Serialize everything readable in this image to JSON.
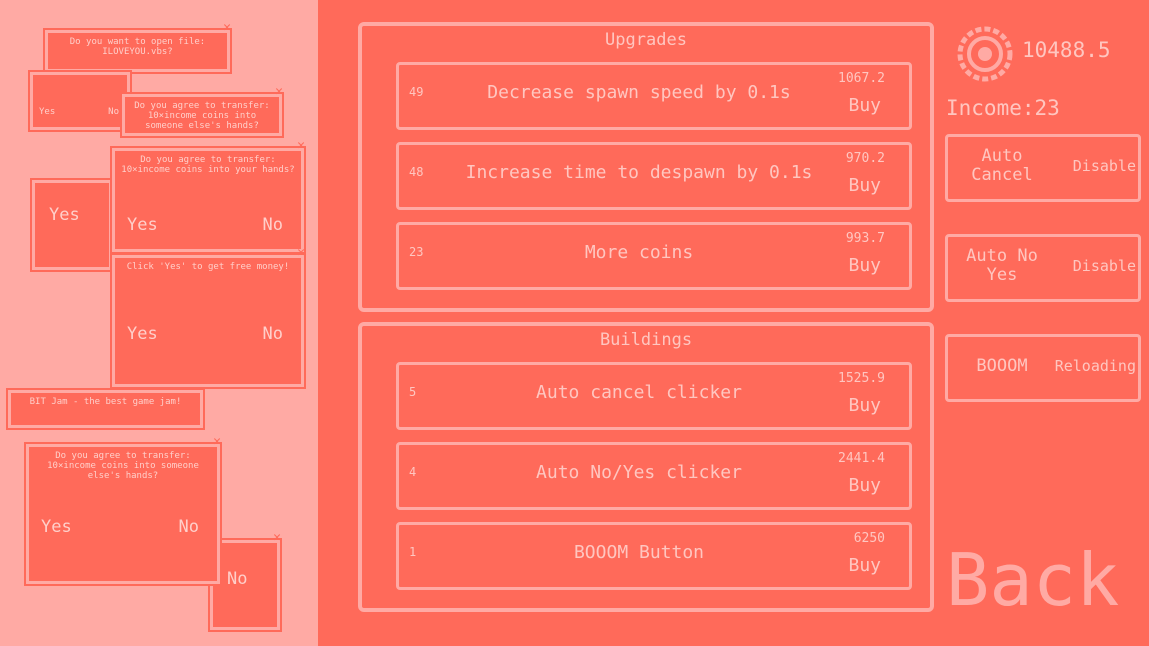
{
  "colors": {
    "background": "#ff6a5a",
    "accent": "#ffaaa4"
  },
  "popups": [
    {
      "msg": "Do you want to open file: ILOVEYOU.vbs?",
      "yes": "",
      "no": ""
    },
    {
      "msg": "Do you agree to transfer: 10×income coins into someone else's hands?",
      "yes": "Yes",
      "no": "No"
    },
    {
      "msg": "Do you agree to transfer: 10×income coins into your hands?",
      "yes": "Yes",
      "no": "No"
    },
    {
      "msg": "Click 'Yes' to get free money!",
      "yes": "Yes",
      "no": "No"
    },
    {
      "msg": "BIT Jam - the best game jam!",
      "yes": "",
      "no": ""
    },
    {
      "msg": "Do you agree to transfer: 10×income coins into someone else's hands?",
      "yes": "Yes",
      "no": "No"
    },
    {
      "msg": "",
      "yes": "Yes",
      "no": ""
    },
    {
      "msg": "",
      "yes": "",
      "no": "No"
    }
  ],
  "upgrades": {
    "title": "Upgrades",
    "items": [
      {
        "count": "49",
        "name": "Decrease spawn speed by 0.1s",
        "price": "1067.2",
        "buy": "Buy"
      },
      {
        "count": "48",
        "name": "Increase time to despawn by 0.1s",
        "price": "970.2",
        "buy": "Buy"
      },
      {
        "count": "23",
        "name": "More coins",
        "price": "993.7",
        "buy": "Buy"
      }
    ]
  },
  "buildings": {
    "title": "Buildings",
    "items": [
      {
        "count": "5",
        "name": "Auto cancel clicker",
        "price": "1525.9",
        "buy": "Buy"
      },
      {
        "count": "4",
        "name": "Auto No/Yes clicker",
        "price": "2441.4",
        "buy": "Buy"
      },
      {
        "count": "1",
        "name": "BOOOM Button",
        "price": "6250",
        "buy": "Buy"
      }
    ]
  },
  "stats": {
    "coins": "10488.5",
    "income": "Income:23",
    "coin_icon": "coin-icon"
  },
  "toggles": [
    {
      "label": "Auto Cancel",
      "action": "Disable"
    },
    {
      "label": "Auto No Yes",
      "action": "Disable"
    },
    {
      "label": "BOOOM",
      "action": "Reloading"
    }
  ],
  "back_label": "Back"
}
